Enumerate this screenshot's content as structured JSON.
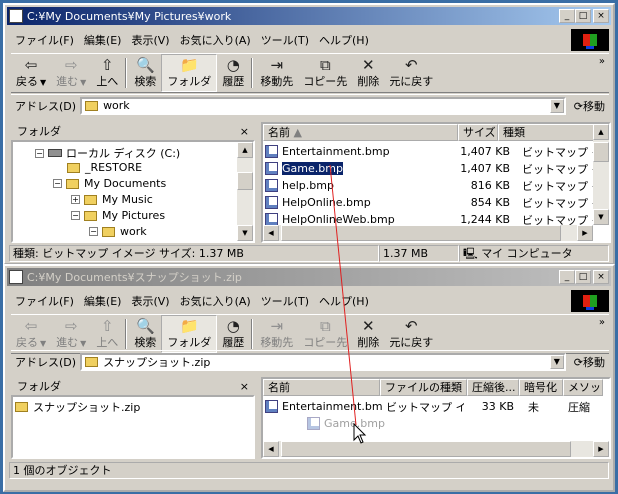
{
  "window1": {
    "title": "C:¥My Documents¥My Pictures¥work",
    "menu": [
      "ファイル(F)",
      "編集(E)",
      "表示(V)",
      "お気に入り(A)",
      "ツール(T)",
      "ヘルプ(H)"
    ],
    "toolbar": {
      "back": "戻る",
      "forward": "進む",
      "up": "上へ",
      "search": "検索",
      "folders": "フォルダ",
      "history": "履歴",
      "move_to": "移動先",
      "copy_to": "コピー先",
      "delete": "削除",
      "undo": "元に戻す"
    },
    "address_label": "アドレス(D)",
    "address_value": "work",
    "go_label": "移動",
    "folder_pane_title": "フォルダ",
    "tree": [
      {
        "label": "ローカル ディスク (C:)",
        "pm": "−"
      },
      {
        "label": "_RESTORE",
        "pm": ""
      },
      {
        "label": "My Documents",
        "pm": "−"
      },
      {
        "label": "My Music",
        "pm": "+"
      },
      {
        "label": "My Pictures",
        "pm": "−"
      },
      {
        "label": "work",
        "pm": "−"
      }
    ],
    "columns": {
      "name": "名前",
      "size": "サイズ",
      "type": "種類"
    },
    "files": [
      {
        "name": "Entertainment.bmp",
        "size": "1,407 KB",
        "type": "ビットマップ イメージ"
      },
      {
        "name": "Game.bmp",
        "size": "1,407 KB",
        "type": "ビットマップ イメージ"
      },
      {
        "name": "help.bmp",
        "size": "816 KB",
        "type": "ビットマップ イメージ"
      },
      {
        "name": "HelpOnline.bmp",
        "size": "854 KB",
        "type": "ビットマップ イメージ"
      },
      {
        "name": "HelpOnlineWeb.bmp",
        "size": "1,244 KB",
        "type": "ビットマップ イメージ"
      }
    ],
    "status": {
      "info": "種類: ビットマップ イメージ サイズ: 1.37 MB",
      "size": "1.37 MB",
      "location": "マイ コンピュータ"
    }
  },
  "window2": {
    "title": "C:¥My Documents¥スナップショット.zip",
    "menu": [
      "ファイル(F)",
      "編集(E)",
      "表示(V)",
      "お気に入り(A)",
      "ツール(T)",
      "ヘルプ(H)"
    ],
    "toolbar": {
      "back": "戻る",
      "forward": "進む",
      "up": "上へ",
      "search": "検索",
      "folders": "フォルダ",
      "history": "履歴",
      "move_to": "移動先",
      "copy_to": "コピー先",
      "delete": "削除",
      "undo": "元に戻す"
    },
    "address_label": "アドレス(D)",
    "address_value": "スナップショット.zip",
    "go_label": "移動",
    "folder_pane_title": "フォルダ",
    "tree_item": "スナップショット.zip",
    "columns": {
      "name": "名前",
      "type": "ファイルの種類",
      "compressed": "圧縮後...",
      "encrypted": "暗号化",
      "method": "メソッ"
    },
    "files": [
      {
        "name": "Entertainment.bmp",
        "type": "ビットマップ イメ...",
        "compressed": "33 KB",
        "encrypted": "未",
        "method": "圧縮"
      }
    ],
    "drag_ghost": "Game.bmp",
    "status": {
      "info": "1 個のオブジェクト"
    }
  },
  "colors": {
    "title_active": "#0a246a",
    "title_inactive": "#808080",
    "desktop": "#3a6ea5",
    "drag_line": "#e02020"
  }
}
